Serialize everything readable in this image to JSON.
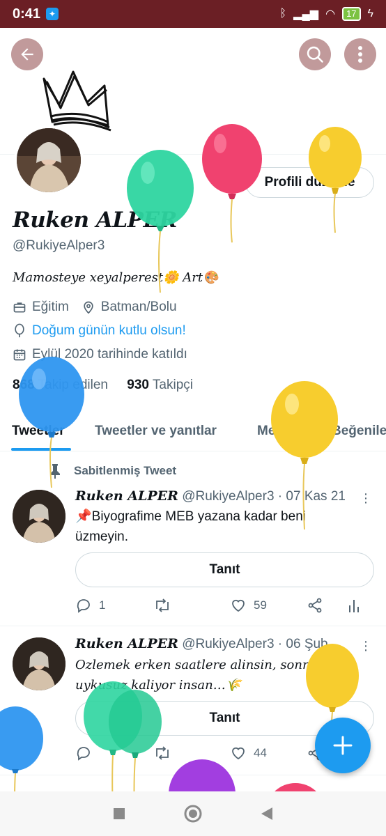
{
  "status_bar": {
    "time": "0:41",
    "battery": "17"
  },
  "profile": {
    "edit_label": "Profili düzenle",
    "name": "Ruken ALPER",
    "handle": "@RukiyeAlper3",
    "bio": "Mamosteye xeyalperest🌼  Art🎨",
    "job": "Eğitim",
    "location": "Batman/Bolu",
    "birthday": "Doğum günün kutlu olsun!",
    "joined": "Eylül 2020 tarihinde katıldı",
    "following_count": "868",
    "following_label": "Takip edilen",
    "followers_count": "930",
    "followers_label": "Takipçi"
  },
  "tabs": [
    "Tweetler",
    "Tweetler ve yanıtlar",
    "Medya",
    "Beğeniler"
  ],
  "pinned_label": "Sabitlenmiş Tweet",
  "tweets": [
    {
      "name": "Ruken ALPER",
      "meta": "@RukiyeAlper3 · 07 Kas 21",
      "text": "📌Biyografime MEB yazana kadar beni üzmeyin.",
      "button": "Tanıt",
      "replies": "1",
      "retweets": "",
      "likes": "59"
    },
    {
      "name": "Ruken ALPER",
      "meta": "@RukiyeAlper3 · 06 Şub",
      "text": "Ozlemek erken saatlere alinsin, sonra uykusuz kaliyor insan…🌾",
      "button": "Tanıt",
      "replies": "",
      "retweets": "",
      "likes": "44"
    }
  ],
  "colors": {
    "accent": "#1d9bf0",
    "status_bar": "#6b1f25",
    "header_button": "#c19a9b"
  },
  "icons": [
    "back-arrow-icon",
    "search-icon",
    "more-vertical-icon",
    "briefcase-icon",
    "location-pin-icon",
    "balloon-icon",
    "calendar-icon",
    "pin-icon",
    "reply-icon",
    "retweet-icon",
    "like-icon",
    "share-icon",
    "analytics-icon",
    "plus-icon"
  ]
}
